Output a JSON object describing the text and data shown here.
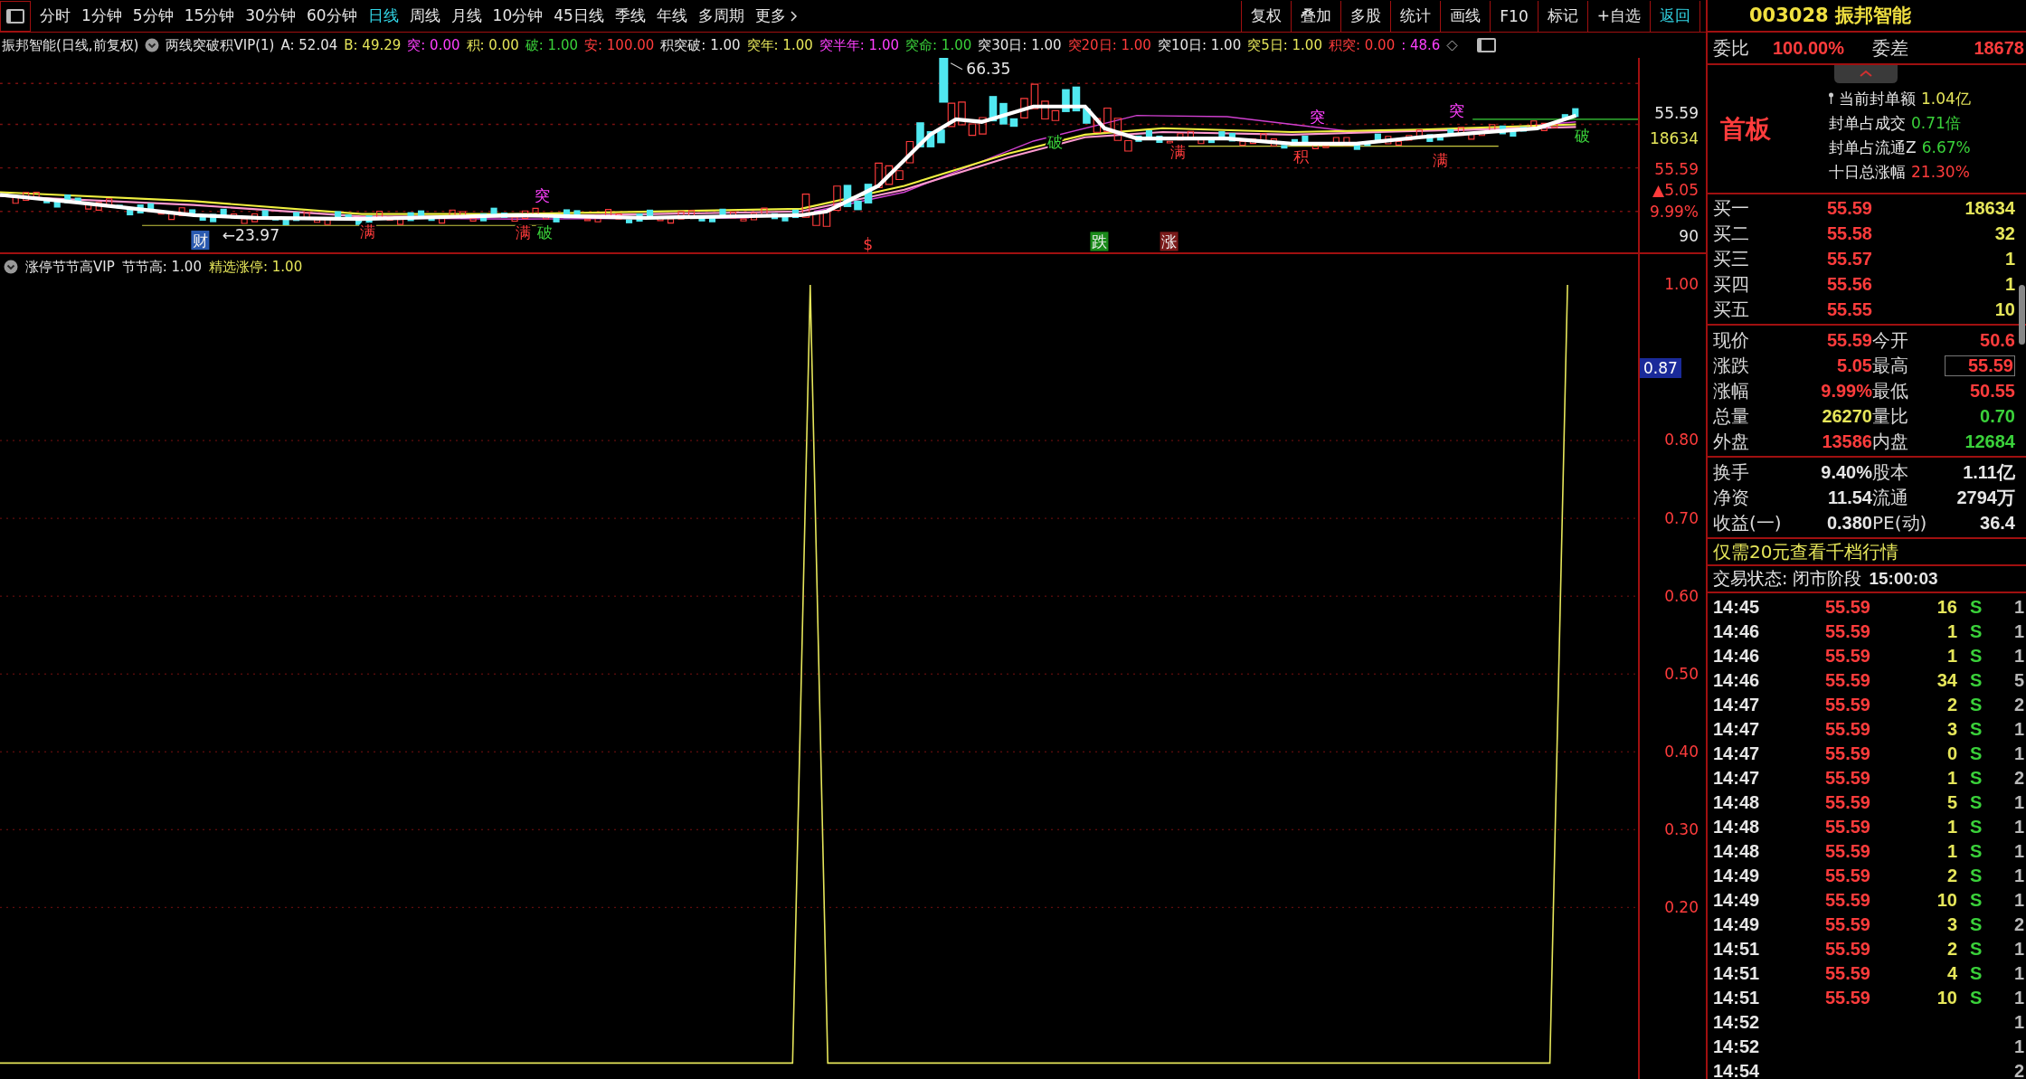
{
  "toolbar": {
    "periods": [
      {
        "label": "分时",
        "selected": false
      },
      {
        "label": "1分钟",
        "selected": false
      },
      {
        "label": "5分钟",
        "selected": false
      },
      {
        "label": "15分钟",
        "selected": false
      },
      {
        "label": "30分钟",
        "selected": false
      },
      {
        "label": "60分钟",
        "selected": false
      },
      {
        "label": "日线",
        "selected": true
      },
      {
        "label": "周线",
        "selected": false
      },
      {
        "label": "月线",
        "selected": false
      },
      {
        "label": "10分钟",
        "selected": false
      },
      {
        "label": "45日线",
        "selected": false
      },
      {
        "label": "季线",
        "selected": false
      },
      {
        "label": "年线",
        "selected": false
      },
      {
        "label": "多周期",
        "selected": false
      }
    ],
    "more": "更多",
    "tools": [
      "复权",
      "叠加",
      "多股",
      "统计",
      "画线",
      "F10",
      "标记",
      "+自选"
    ],
    "back": "返回"
  },
  "chart_header": {
    "title": "振邦智能(日线,前复权)",
    "indicator": "两线突破积VIP(1)",
    "values": [
      {
        "text": "A: 52.04",
        "color": "#e6e6e6"
      },
      {
        "text": "B: 49.29",
        "color": "#e6e65a"
      },
      {
        "text": "突: 0.00",
        "color": "#ff40ff"
      },
      {
        "text": "积: 0.00",
        "color": "#e6e65a"
      },
      {
        "text": "破: 1.00",
        "color": "#3ad13a"
      },
      {
        "text": "安: 100.00",
        "color": "#ff3c3c"
      },
      {
        "text": "积突破: 1.00",
        "color": "#e6e6e6"
      },
      {
        "text": "突年: 1.00",
        "color": "#e6e65a"
      },
      {
        "text": "突半年: 1.00",
        "color": "#ff40ff"
      },
      {
        "text": "突命: 1.00",
        "color": "#3ad13a"
      },
      {
        "text": "突30日: 1.00",
        "color": "#e6e6e6"
      },
      {
        "text": "突20日: 1.00",
        "color": "#ff3c3c"
      },
      {
        "text": "突10日: 1.00",
        "color": "#e6e6e6"
      },
      {
        "text": "突5日: 1.00",
        "color": "#e6e65a"
      },
      {
        "text": "积突: 0.00",
        "color": "#ff3c3c"
      },
      {
        "text": ": 48.6",
        "color": "#ff40ff"
      }
    ]
  },
  "price_chart": {
    "marks": [
      {
        "text": "财",
        "kind": "boxed",
        "color": "#2a5ab0"
      },
      {
        "text": "←23.97",
        "kind": "label",
        "color": "#e6e6e6"
      },
      {
        "text": "满",
        "kind": "plain",
        "color": "#ff3c3c"
      },
      {
        "text": "满",
        "kind": "plain",
        "color": "#ff3c3c"
      },
      {
        "text": "突",
        "kind": "plain",
        "color": "#ff40ff"
      },
      {
        "text": "破",
        "kind": "plain",
        "color": "#3ad13a"
      },
      {
        "text": "$",
        "kind": "plain",
        "color": "#ff3c3c"
      },
      {
        "text": "66.35",
        "kind": "leader",
        "color": "#e6e6e6"
      },
      {
        "text": "破",
        "kind": "plain",
        "color": "#3ad13a"
      },
      {
        "text": "跌",
        "kind": "boxed",
        "color": "#1a8a1a"
      },
      {
        "text": "涨",
        "kind": "boxed",
        "color": "#7a1a1a"
      },
      {
        "text": "满",
        "kind": "plain",
        "color": "#ff3c3c"
      },
      {
        "text": "积",
        "kind": "plain",
        "color": "#ff3c3c"
      },
      {
        "text": "突",
        "kind": "plain",
        "color": "#ff40ff"
      },
      {
        "text": "满",
        "kind": "plain",
        "color": "#ff3c3c"
      },
      {
        "text": "突",
        "kind": "plain",
        "color": "#ff40ff"
      },
      {
        "text": "破",
        "kind": "plain",
        "color": "#3ad13a"
      }
    ],
    "axis": [
      {
        "text": "55.59",
        "color": "#e6e6e6"
      },
      {
        "text": "18634",
        "color": "#e6e65a"
      },
      {
        "text": "55.59",
        "color": "#ff3c3c"
      },
      {
        "text": "▲5.05",
        "color": "#ff3c3c"
      },
      {
        "text": "9.99%",
        "color": "#ff3c3c"
      },
      {
        "text": "90",
        "color": "#e6e6e6"
      }
    ]
  },
  "indicator_header": {
    "title": "涨停节节高VIP",
    "values": [
      {
        "text": "节节高: 1.00",
        "color": "#e6e6e6"
      },
      {
        "text": "精选涨停: 1.00",
        "color": "#e6e65a"
      }
    ]
  },
  "indicator": {
    "cursor_value": "0.87",
    "chart_data": {
      "type": "line",
      "ylim": [
        -0.02,
        1.04
      ],
      "grid": true,
      "yticks": [
        {
          "value": 1,
          "label": "1.00"
        },
        {
          "value": 0.8,
          "label": "0.80"
        },
        {
          "value": 0.7,
          "label": "0.70"
        },
        {
          "value": 0.6,
          "label": "0.60"
        },
        {
          "value": 0.5,
          "label": "0.50"
        },
        {
          "value": 0.4,
          "label": "0.40"
        },
        {
          "value": 0.3,
          "label": "0.30"
        },
        {
          "value": 0.2,
          "label": "0.20"
        }
      ],
      "series": [
        {
          "color": "#e6e65a",
          "values": [
            0,
            0,
            0,
            0,
            0,
            0,
            0,
            0,
            0,
            0,
            0,
            0,
            0,
            0,
            0,
            0,
            0,
            0,
            0,
            0,
            0,
            0,
            0,
            0,
            0,
            0,
            0,
            0,
            0,
            0,
            0,
            0,
            0,
            0,
            0,
            0,
            0,
            0,
            0,
            0,
            0,
            0,
            0,
            0,
            0,
            0,
            1,
            0,
            0,
            0,
            0,
            0,
            0,
            0,
            0,
            0,
            0,
            0,
            0,
            0,
            0,
            0,
            0,
            0,
            0,
            0,
            0,
            0,
            0,
            0,
            0,
            0,
            0,
            0,
            0,
            0,
            0,
            0,
            0,
            0,
            0,
            0,
            0,
            0,
            0,
            0,
            0,
            0,
            0,
            1,
            null,
            null,
            null,
            null
          ]
        }
      ]
    }
  },
  "quote": {
    "code": "003028",
    "name": "振邦智能",
    "committee": [
      {
        "label": "委比",
        "value": "100.00%"
      },
      {
        "label": "委差",
        "value": "18678"
      }
    ],
    "board": "首板",
    "seal_info": [
      {
        "label": "当前封单额",
        "value": "1.04亿",
        "color": "#e6e65a"
      },
      {
        "label": "封单占成交",
        "value": "0.71倍",
        "color": "#3ad13a"
      },
      {
        "label": "封单占流通Z",
        "value": "6.67%",
        "color": "#3ad13a"
      },
      {
        "label": "十日总涨幅",
        "value": "21.30%",
        "color": "#ff3c3c"
      }
    ],
    "bids": [
      {
        "label": "买一",
        "price": "55.59",
        "volume": "18634"
      },
      {
        "label": "买二",
        "price": "55.58",
        "volume": "32"
      },
      {
        "label": "买三",
        "price": "55.57",
        "volume": "1"
      },
      {
        "label": "买四",
        "price": "55.56",
        "volume": "1"
      },
      {
        "label": "买五",
        "price": "55.55",
        "volume": "10"
      }
    ],
    "stats": [
      {
        "label": "现价",
        "value": "55.59",
        "color": "#ff3c3c",
        "highlighted": false
      },
      {
        "label": "今开",
        "value": "50.6",
        "color": "#ff3c3c",
        "highlighted": false
      },
      {
        "label": "涨跌",
        "value": "5.05",
        "color": "#ff3c3c",
        "highlighted": false
      },
      {
        "label": "最高",
        "value": "55.59",
        "color": "#ff3c3c",
        "highlighted": true
      },
      {
        "label": "涨幅",
        "value": "9.99%",
        "color": "#ff3c3c",
        "highlighted": false
      },
      {
        "label": "最低",
        "value": "50.55",
        "color": "#ff3c3c",
        "highlighted": false
      },
      {
        "label": "总量",
        "value": "26270",
        "color": "#e6e65a",
        "highlighted": false
      },
      {
        "label": "量比",
        "value": "0.70",
        "color": "#3ad13a",
        "highlighted": false
      },
      {
        "label": "外盘",
        "value": "13586",
        "color": "#ff3c3c",
        "highlighted": false
      },
      {
        "label": "内盘",
        "value": "12684",
        "color": "#3ad13a",
        "highlighted": false
      }
    ],
    "fundamentals": [
      {
        "label": "换手",
        "value": "9.40%"
      },
      {
        "label": "股本",
        "value": "1.11亿"
      },
      {
        "label": "净资",
        "value": "11.54"
      },
      {
        "label": "流通",
        "value": "2794万"
      },
      {
        "label": "收益(一)",
        "value": "0.380"
      },
      {
        "label": "PE(动)",
        "value": "36.4"
      }
    ],
    "promo": "仅需20元查看千档行情",
    "status": "交易状态: 闭市阶段",
    "status_time": "15:00:03"
  },
  "ticks": [
    {
      "time": "14:45",
      "price": "55.59",
      "volume": "16",
      "side": "S",
      "count": "1"
    },
    {
      "time": "14:46",
      "price": "55.59",
      "volume": "1",
      "side": "S",
      "count": "1"
    },
    {
      "time": "14:46",
      "price": "55.59",
      "volume": "1",
      "side": "S",
      "count": "1"
    },
    {
      "time": "14:46",
      "price": "55.59",
      "volume": "34",
      "side": "S",
      "count": "5"
    },
    {
      "time": "14:47",
      "price": "55.59",
      "volume": "2",
      "side": "S",
      "count": "2"
    },
    {
      "time": "14:47",
      "price": "55.59",
      "volume": "3",
      "side": "S",
      "count": "1"
    },
    {
      "time": "14:47",
      "price": "55.59",
      "volume": "0",
      "side": "S",
      "count": "1"
    },
    {
      "time": "14:47",
      "price": "55.59",
      "volume": "1",
      "side": "S",
      "count": "2"
    },
    {
      "time": "14:48",
      "price": "55.59",
      "volume": "5",
      "side": "S",
      "count": "1"
    },
    {
      "time": "14:48",
      "price": "55.59",
      "volume": "1",
      "side": "S",
      "count": "1"
    },
    {
      "time": "14:48",
      "price": "55.59",
      "volume": "1",
      "side": "S",
      "count": "1"
    },
    {
      "time": "14:49",
      "price": "55.59",
      "volume": "2",
      "side": "S",
      "count": "1"
    },
    {
      "time": "14:49",
      "price": "55.59",
      "volume": "10",
      "side": "S",
      "count": "1"
    },
    {
      "time": "14:49",
      "price": "55.59",
      "volume": "3",
      "side": "S",
      "count": "2"
    },
    {
      "time": "14:51",
      "price": "55.59",
      "volume": "2",
      "side": "S",
      "count": "1"
    },
    {
      "time": "14:51",
      "price": "55.59",
      "volume": "4",
      "side": "S",
      "count": "1"
    },
    {
      "time": "14:51",
      "price": "55.59",
      "volume": "10",
      "side": "S",
      "count": "1"
    },
    {
      "time": "14:52",
      "count": "1"
    },
    {
      "time": "14:52",
      "count": "1"
    },
    {
      "time": "14:54",
      "count": "2"
    }
  ]
}
